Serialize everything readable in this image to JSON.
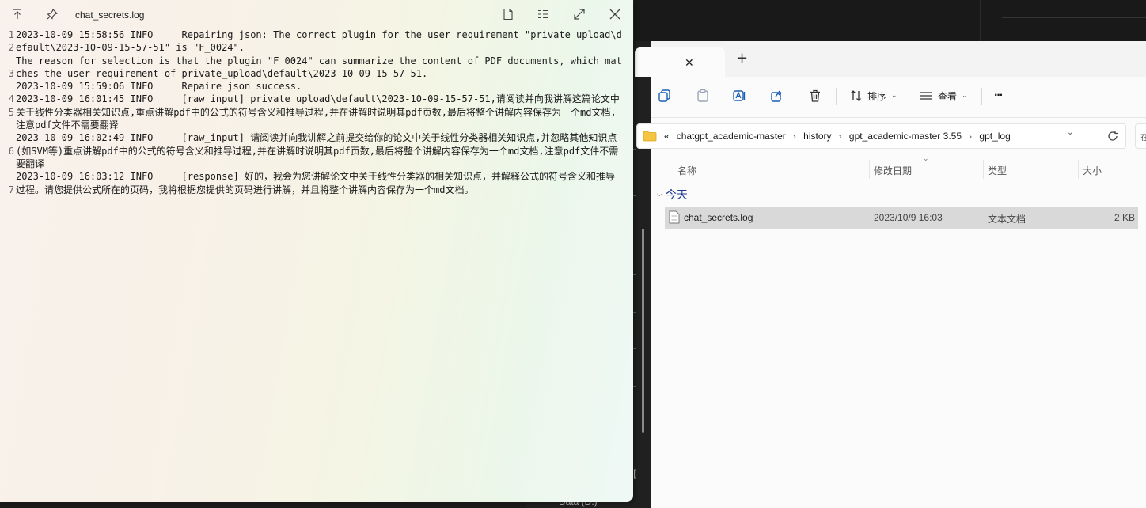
{
  "notepad": {
    "title": "chat_secrets.log",
    "line_numbers": [
      "1",
      "2",
      "3",
      "4",
      "5",
      "6",
      "7"
    ],
    "lines": [
      "2023-10-09 15:58:56 INFO     Repairing json: The correct plugin for the user requirement \"private_upload\\default\\2023-10-09-15-57-51\" is \"F_0024\".",
      "The reason for selection is that the plugin \"F_0024\" can summarize the content of PDF documents, which matches the user requirement of private_upload\\default\\2023-10-09-15-57-51.",
      "2023-10-09 15:59:06 INFO     Repaire json success.",
      "2023-10-09 16:01:45 INFO     [raw_input] private_upload\\default\\2023-10-09-15-57-51,请阅读并向我讲解这篇论文中关于线性分类器相关知识点,重点讲解pdf中的公式的符号含义和推导过程,并在讲解时说明其pdf页数,最后将整个讲解内容保存为一个md文档,注意pdf文件不需要翻译",
      "2023-10-09 16:02:49 INFO     [raw_input] 请阅读并向我讲解之前提交给你的论文中关于线性分类器相关知识点,并忽略其他知识点(如SVM等)重点讲解pdf中的公式的符号含义和推导过程,并在讲解时说明其pdf页数,最后将整个讲解内容保存为一个md文档,注意pdf文件不需要翻译",
      "2023-10-09 16:03:12 INFO     [response] 好的，我会为您讲解论文中关于线性分类器的相关知识点，并解释公式的符号含义和推导过程。请您提供公式所在的页码，我将根据您提供的页码进行讲解，并且将整个讲解内容保存为一个md文档。",
      ""
    ]
  },
  "explorer": {
    "toolbar": {
      "sort_label": "排序",
      "view_label": "查看",
      "more_label": "···"
    },
    "address": {
      "overflow": "«",
      "crumbs": [
        "chatgpt_academic-master",
        "history",
        "gpt_academic-master 3.55",
        "gpt_log"
      ],
      "separator": "›",
      "search_stub": "在"
    },
    "columns": {
      "name": "名称",
      "modified": "修改日期",
      "type": "类型",
      "size": "大小"
    },
    "group": "今天",
    "file": {
      "name": "chat_secrets.log",
      "modified": "2023/10/9 16:03",
      "type": "文本文档",
      "size": "2 KB"
    }
  },
  "background": {
    "bottom_text": "Data (D:)",
    "edge_bracket": "["
  }
}
